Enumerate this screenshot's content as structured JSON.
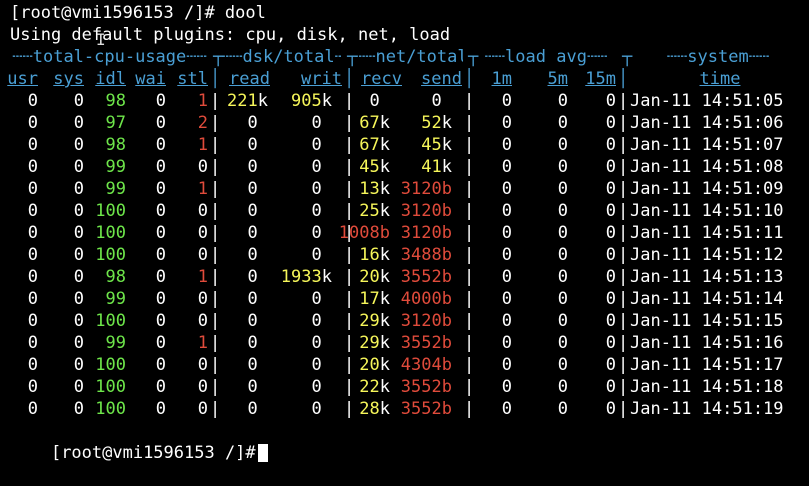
{
  "prompt_line": "[root@vmi1596153 /]# dool",
  "info_line": "Using default plugins: cpu, disk, net, load",
  "group_headers": [
    "total-cpu-usage",
    "dsk/total",
    "net/total",
    "load avg",
    "system"
  ],
  "column_headers": [
    "usr",
    "sys",
    "idl",
    "wai",
    "stl",
    "read",
    "writ",
    "recv",
    "send",
    "1m",
    "5m",
    "15m",
    "time"
  ],
  "colors": {
    "white": "#ffffff",
    "green": "#6ee64a",
    "red": "#e04b3b",
    "yellow": "#f6f65a",
    "blue": "#4a9fd4"
  },
  "rows": [
    {
      "usr": "0",
      "sys": "0",
      "idl": "98",
      "wai": "0",
      "stl": "1",
      "read": "221",
      "read_u": "k",
      "writ": "905",
      "writ_u": "k",
      "recv": "0",
      "recv_u": "",
      "send": "0",
      "send_u": "",
      "l1": "0",
      "l5": "0",
      "l15": "0",
      "time": "Jan-11 14:51:05"
    },
    {
      "usr": "0",
      "sys": "0",
      "idl": "97",
      "wai": "0",
      "stl": "2",
      "read": "0",
      "read_u": "",
      "writ": "0",
      "writ_u": "",
      "recv": "67",
      "recv_u": "k",
      "send": "52",
      "send_u": "k",
      "l1": "0",
      "l5": "0",
      "l15": "0",
      "time": "Jan-11 14:51:06"
    },
    {
      "usr": "0",
      "sys": "0",
      "idl": "98",
      "wai": "0",
      "stl": "1",
      "read": "0",
      "read_u": "",
      "writ": "0",
      "writ_u": "",
      "recv": "67",
      "recv_u": "k",
      "send": "45",
      "send_u": "k",
      "l1": "0",
      "l5": "0",
      "l15": "0",
      "time": "Jan-11 14:51:07"
    },
    {
      "usr": "0",
      "sys": "0",
      "idl": "99",
      "wai": "0",
      "stl": "0",
      "read": "0",
      "read_u": "",
      "writ": "0",
      "writ_u": "",
      "recv": "45",
      "recv_u": "k",
      "send": "41",
      "send_u": "k",
      "l1": "0",
      "l5": "0",
      "l15": "0",
      "time": "Jan-11 14:51:08"
    },
    {
      "usr": "0",
      "sys": "0",
      "idl": "99",
      "wai": "0",
      "stl": "1",
      "read": "0",
      "read_u": "",
      "writ": "0",
      "writ_u": "",
      "recv": "13",
      "recv_u": "k",
      "send": "3120",
      "send_u": "b",
      "l1": "0",
      "l5": "0",
      "l15": "0",
      "time": "Jan-11 14:51:09"
    },
    {
      "usr": "0",
      "sys": "0",
      "idl": "100",
      "wai": "0",
      "stl": "0",
      "read": "0",
      "read_u": "",
      "writ": "0",
      "writ_u": "",
      "recv": "25",
      "recv_u": "k",
      "send": "3120",
      "send_u": "b",
      "l1": "0",
      "l5": "0",
      "l15": "0",
      "time": "Jan-11 14:51:10"
    },
    {
      "usr": "0",
      "sys": "0",
      "idl": "100",
      "wai": "0",
      "stl": "0",
      "read": "0",
      "read_u": "",
      "writ": "0",
      "writ_u": "",
      "recv": "1008",
      "recv_u": "b",
      "send": "3120",
      "send_u": "b",
      "l1": "0",
      "l5": "0",
      "l15": "0",
      "time": "Jan-11 14:51:11"
    },
    {
      "usr": "0",
      "sys": "0",
      "idl": "100",
      "wai": "0",
      "stl": "0",
      "read": "0",
      "read_u": "",
      "writ": "0",
      "writ_u": "",
      "recv": "16",
      "recv_u": "k",
      "send": "3488",
      "send_u": "b",
      "l1": "0",
      "l5": "0",
      "l15": "0",
      "time": "Jan-11 14:51:12"
    },
    {
      "usr": "0",
      "sys": "0",
      "idl": "98",
      "wai": "0",
      "stl": "1",
      "read": "0",
      "read_u": "",
      "writ": "1933",
      "writ_u": "k",
      "recv": "20",
      "recv_u": "k",
      "send": "3552",
      "send_u": "b",
      "l1": "0",
      "l5": "0",
      "l15": "0",
      "time": "Jan-11 14:51:13"
    },
    {
      "usr": "0",
      "sys": "0",
      "idl": "99",
      "wai": "0",
      "stl": "0",
      "read": "0",
      "read_u": "",
      "writ": "0",
      "writ_u": "",
      "recv": "17",
      "recv_u": "k",
      "send": "4000",
      "send_u": "b",
      "l1": "0",
      "l5": "0",
      "l15": "0",
      "time": "Jan-11 14:51:14"
    },
    {
      "usr": "0",
      "sys": "0",
      "idl": "100",
      "wai": "0",
      "stl": "0",
      "read": "0",
      "read_u": "",
      "writ": "0",
      "writ_u": "",
      "recv": "29",
      "recv_u": "k",
      "send": "3120",
      "send_u": "b",
      "l1": "0",
      "l5": "0",
      "l15": "0",
      "time": "Jan-11 14:51:15"
    },
    {
      "usr": "0",
      "sys": "0",
      "idl": "99",
      "wai": "0",
      "stl": "1",
      "read": "0",
      "read_u": "",
      "writ": "0",
      "writ_u": "",
      "recv": "29",
      "recv_u": "k",
      "send": "3552",
      "send_u": "b",
      "l1": "0",
      "l5": "0",
      "l15": "0",
      "time": "Jan-11 14:51:16"
    },
    {
      "usr": "0",
      "sys": "0",
      "idl": "100",
      "wai": "0",
      "stl": "0",
      "read": "0",
      "read_u": "",
      "writ": "0",
      "writ_u": "",
      "recv": "20",
      "recv_u": "k",
      "send": "4304",
      "send_u": "b",
      "l1": "0",
      "l5": "0",
      "l15": "0",
      "time": "Jan-11 14:51:17"
    },
    {
      "usr": "0",
      "sys": "0",
      "idl": "100",
      "wai": "0",
      "stl": "0",
      "read": "0",
      "read_u": "",
      "writ": "0",
      "writ_u": "",
      "recv": "22",
      "recv_u": "k",
      "send": "3552",
      "send_u": "b",
      "l1": "0",
      "l5": "0",
      "l15": "0",
      "time": "Jan-11 14:51:18"
    },
    {
      "usr": "0",
      "sys": "0",
      "idl": "100",
      "wai": "0",
      "stl": "0",
      "read": "0",
      "read_u": "",
      "writ": "0",
      "writ_u": "",
      "recv": "28",
      "recv_u": "k",
      "send": "3552",
      "send_u": "b",
      "l1": "0",
      "l5": "0",
      "l15": "0",
      "time": "Jan-11 14:51:19"
    }
  ],
  "final_prompt": "[root@vmi1596153 /]#"
}
